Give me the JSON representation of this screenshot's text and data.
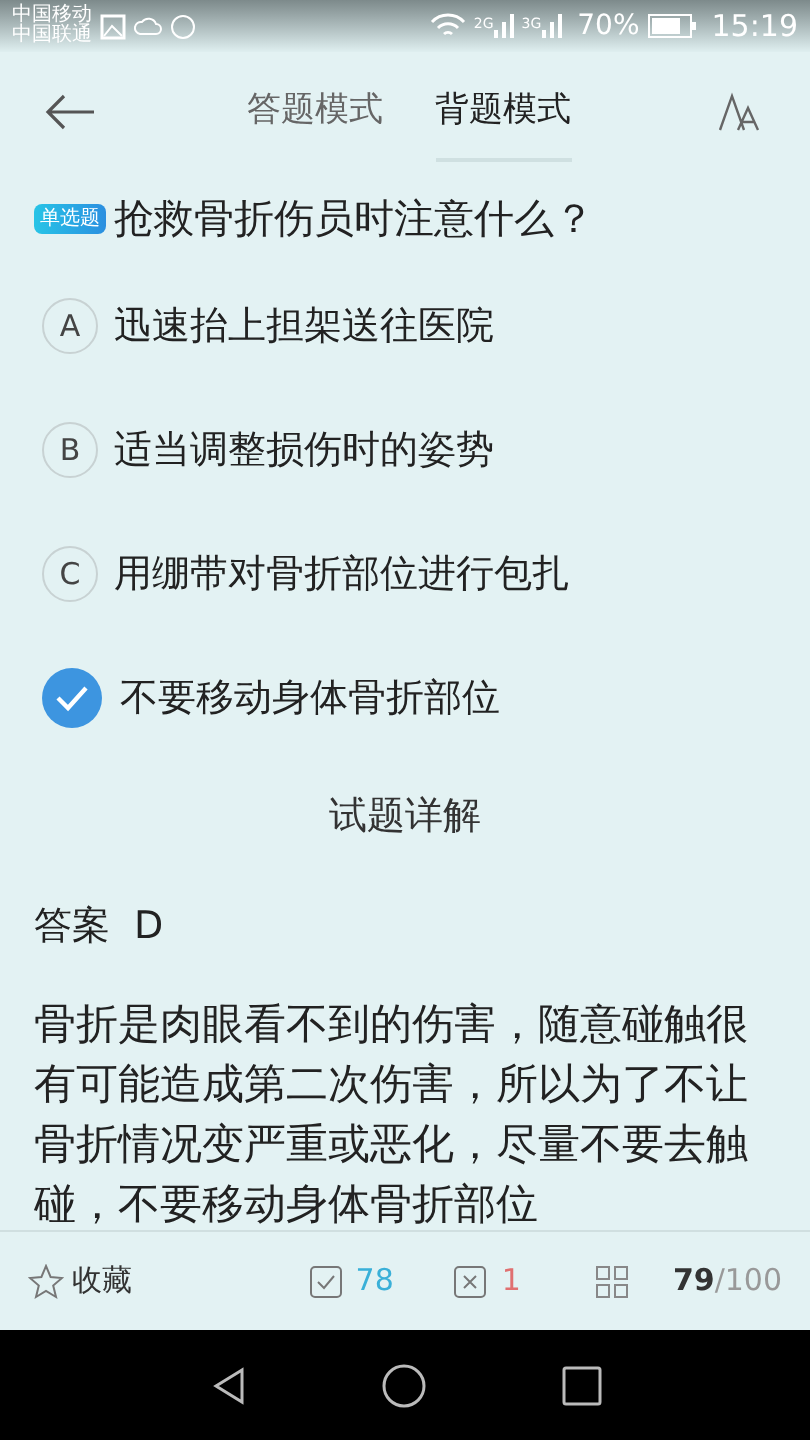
{
  "status_bar": {
    "carriers": [
      "中国移动",
      "中国联通"
    ],
    "network_labels": [
      "2G",
      "3G"
    ],
    "battery": "70%",
    "time": "15:19"
  },
  "tabs": [
    {
      "label": "答题模式",
      "selected": false
    },
    {
      "label": "背题模式",
      "selected": true
    }
  ],
  "question": {
    "badge": "单选题",
    "text": "抢救骨折伤员时注意什么？"
  },
  "options": [
    {
      "letter": "A",
      "text": "迅速抬上担架送往医院",
      "selected": false
    },
    {
      "letter": "B",
      "text": "适当调整损伤时的姿势",
      "selected": false
    },
    {
      "letter": "C",
      "text": "用绷带对骨折部位进行包扎",
      "selected": false
    },
    {
      "text": "不要移动身体骨折部位",
      "selected": true
    }
  ],
  "detail_title": "试题详解",
  "answer": {
    "label": "答案",
    "value": "D"
  },
  "explanation": "骨折是肉眼看不到的伤害，随意碰触很有可能造成第二次伤害，所以为了不让骨折情况变严重或恶化，尽量不要去触碰，不要移动身体骨折部位",
  "bottom_bar": {
    "favorite": "收藏",
    "correct": "78",
    "wrong": "1",
    "current": "79",
    "total": "/100"
  }
}
